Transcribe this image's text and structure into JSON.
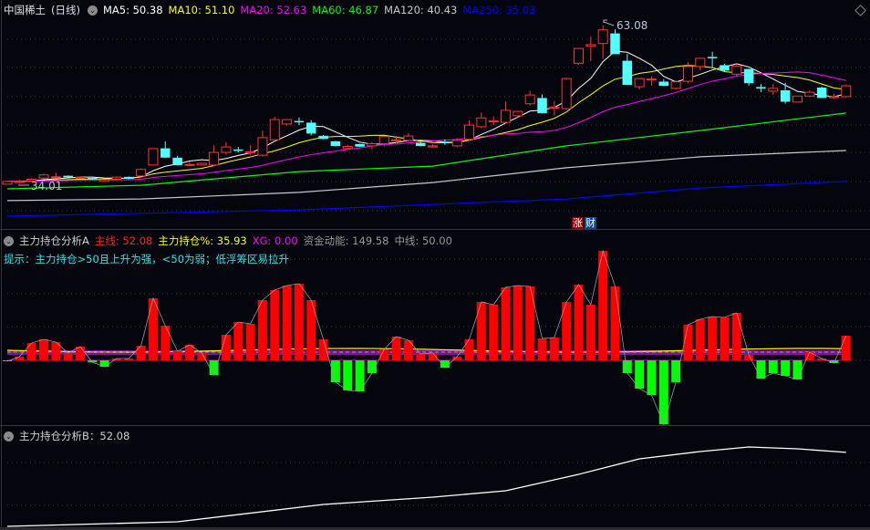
{
  "main": {
    "stock_name": "中国稀土",
    "period": "(日线)",
    "ma_labels": [
      {
        "text": "MA5: 50.38",
        "color": "#ffffff"
      },
      {
        "text": "MA10: 51.10",
        "color": "#ffff00"
      },
      {
        "text": "MA20: 52.63",
        "color": "#ff00ff"
      },
      {
        "text": "MA60: 46.87",
        "color": "#00ff00"
      },
      {
        "text": "MA120: 40.43",
        "color": "#c8c8c8"
      },
      {
        "text": "MA250: 35.03",
        "color": "#0000ff"
      }
    ],
    "high_label": "63.08",
    "low_label": "34.01",
    "tag1": "涨",
    "tag2": "财",
    "colors": {
      "up": "#ff3232",
      "down": "#54ffff"
    }
  },
  "panel_a": {
    "title": "主力持仓分析A",
    "items": [
      {
        "text": "主线: 52.08",
        "color": "#ff2020"
      },
      {
        "text": "主力持仓%: 35.93",
        "color": "#ffff00"
      },
      {
        "text": "XG: 0.00",
        "color": "#ff00ff"
      },
      {
        "text": "资金动能: 149.58",
        "color": "#9a9a9a"
      },
      {
        "text": "中线: 50.00",
        "color": "#9a9a9a"
      }
    ],
    "hint": "提示：主力持仓>50且上升为强，<50为弱；低浮筹区易拉升"
  },
  "panel_b": {
    "title": "主力持仓分析B：52.08"
  },
  "chart_data": [
    {
      "type": "candlestick",
      "title": "中国稀土 (日线)",
      "price_range": [
        26.5,
        65
      ],
      "ohlc": [
        [
          34.1,
          34.7,
          34.01,
          34.6
        ],
        [
          34.4,
          34.9,
          34.2,
          34.6
        ],
        [
          34.7,
          35.2,
          34.5,
          35.0
        ],
        [
          35.2,
          36.0,
          35.0,
          35.8
        ],
        [
          35.4,
          36.2,
          35.3,
          35.45
        ],
        [
          35.6,
          35.7,
          35.3,
          35.4
        ],
        [
          35.3,
          35.5,
          35.1,
          35.35
        ],
        [
          35.2,
          35.3,
          34.9,
          35.0
        ],
        [
          34.6,
          35.0,
          34.5,
          34.9
        ],
        [
          35.0,
          35.5,
          34.9,
          35.4
        ],
        [
          35.4,
          35.5,
          35.0,
          35.1
        ],
        [
          35.6,
          37.0,
          35.5,
          36.8
        ],
        [
          37.6,
          40.6,
          37.5,
          40.6
        ],
        [
          40.6,
          41.9,
          38.9,
          39.0
        ],
        [
          38.9,
          39.3,
          37.5,
          37.6
        ],
        [
          37.6,
          38.2,
          37.4,
          37.7
        ],
        [
          37.6,
          38.0,
          37.5,
          37.9
        ],
        [
          37.6,
          41.2,
          37.4,
          39.9
        ],
        [
          39.9,
          41.8,
          39.5,
          40.9
        ],
        [
          40.4,
          40.9,
          39.9,
          40.35
        ],
        [
          39.8,
          41.2,
          39.5,
          40.0
        ],
        [
          39.4,
          43.9,
          39.2,
          42.6
        ],
        [
          42.2,
          46.4,
          41.9,
          45.9
        ],
        [
          45.1,
          46.0,
          44.8,
          45.9
        ],
        [
          45.6,
          46.3,
          44.9,
          45.5
        ],
        [
          45.3,
          45.8,
          43.0,
          43.4
        ],
        [
          42.9,
          43.1,
          42.3,
          42.4
        ],
        [
          41.9,
          42.0,
          41.0,
          41.1
        ],
        [
          40.6,
          41.3,
          40.4,
          41.0
        ],
        [
          41.4,
          41.5,
          40.9,
          41.0
        ],
        [
          41.1,
          41.8,
          40.5,
          41.5
        ],
        [
          41.5,
          42.9,
          41.0,
          42.8
        ],
        [
          42.1,
          42.9,
          41.6,
          42.2
        ],
        [
          42.1,
          43.4,
          41.9,
          42.9
        ],
        [
          41.6,
          41.8,
          41.0,
          41.1
        ],
        [
          40.9,
          41.4,
          40.8,
          41.1
        ],
        [
          41.8,
          42.3,
          41.3,
          41.7
        ],
        [
          41.1,
          42.5,
          40.9,
          42.1
        ],
        [
          42.3,
          45.8,
          42.0,
          44.9
        ],
        [
          44.6,
          47.2,
          44.3,
          46.2
        ],
        [
          45.6,
          46.5,
          44.9,
          45.65
        ],
        [
          45.4,
          49.2,
          45.2,
          47.6
        ],
        [
          46.6,
          47.5,
          46.3,
          47.4
        ],
        [
          48.8,
          51.2,
          48.5,
          50.4
        ],
        [
          49.8,
          50.5,
          47.0,
          47.1
        ],
        [
          48.0,
          49.3,
          46.6,
          48.2
        ],
        [
          47.9,
          53.6,
          47.7,
          53.4
        ],
        [
          56.2,
          59.0,
          55.9,
          58.9
        ],
        [
          59.3,
          61.1,
          56.6,
          59.6
        ],
        [
          59.8,
          63.08,
          57.0,
          62.3
        ],
        [
          61.6,
          62.4,
          58.0,
          57.9
        ],
        [
          56.6,
          57.9,
          52.2,
          52.3
        ],
        [
          51.9,
          53.5,
          51.4,
          53.4
        ],
        [
          53.2,
          53.8,
          52.1,
          53.3
        ],
        [
          52.8,
          53.3,
          52.0,
          52.1
        ],
        [
          51.6,
          53.1,
          51.4,
          52.8
        ],
        [
          52.9,
          56.4,
          52.6,
          55.6
        ],
        [
          55.6,
          57.2,
          54.9,
          57.1
        ],
        [
          57.3,
          58.3,
          55.3,
          57.25
        ],
        [
          55.8,
          56.1,
          54.7,
          54.9
        ],
        [
          54.2,
          56.1,
          53.8,
          55.7
        ],
        [
          55.1,
          55.2,
          52.1,
          52.6
        ],
        [
          51.8,
          52.4,
          50.9,
          51.75
        ],
        [
          51.1,
          52.4,
          50.4,
          51.6
        ],
        [
          51.2,
          52.6,
          48.8,
          49.2
        ],
        [
          49.1,
          50.2,
          49.0,
          50.2
        ],
        [
          50.2,
          51.2,
          50.0,
          50.9
        ],
        [
          51.7,
          51.9,
          49.8,
          49.9
        ],
        [
          49.9,
          50.6,
          49.7,
          50.1
        ],
        [
          50.1,
          52.3,
          49.9,
          52.08
        ]
      ],
      "ma_long": {
        "MA60": [
          [
            0,
            33.25
          ],
          [
            11,
            33.9
          ],
          [
            24,
            36.4
          ],
          [
            35,
            37.4
          ],
          [
            46,
            41.1
          ],
          [
            57,
            43.9
          ],
          [
            69,
            47.1
          ]
        ],
        "MA120": [
          [
            0,
            31.1
          ],
          [
            11,
            31.4
          ],
          [
            24,
            32.6
          ],
          [
            35,
            34.4
          ],
          [
            46,
            37.1
          ],
          [
            57,
            39.1
          ],
          [
            69,
            40.25
          ]
        ],
        "MA250": [
          [
            0,
            28.25
          ],
          [
            24,
            29.4
          ],
          [
            35,
            30.4
          ],
          [
            46,
            31.4
          ],
          [
            57,
            33.4
          ],
          [
            69,
            34.6
          ]
        ]
      }
    },
    {
      "type": "bar",
      "title": "主力持仓分析A",
      "value_range": [
        -75,
        125
      ],
      "values": [
        -1,
        4,
        19,
        23,
        20,
        8,
        15,
        -2,
        -7,
        2,
        2,
        16,
        68,
        38,
        10,
        17,
        8,
        -16,
        28,
        42,
        40,
        66,
        77,
        82,
        84,
        66,
        23,
        -24,
        -33,
        -34,
        -14,
        12,
        26,
        22,
        7,
        8,
        -8,
        4,
        23,
        64,
        61,
        80,
        82,
        81,
        24,
        25,
        64,
        83,
        61,
        120,
        81,
        -14,
        -31,
        -38,
        -70,
        -24,
        39,
        45,
        48,
        47,
        52,
        6,
        -20,
        -14,
        -17,
        -21,
        9,
        2,
        -3,
        27
      ]
    },
    {
      "type": "line",
      "title": "主力持仓分析B",
      "value_range": [
        0,
        75
      ],
      "points": [
        [
          0,
          11.5
        ],
        [
          14,
          14
        ],
        [
          26,
          23.5
        ],
        [
          35,
          27.5
        ],
        [
          41,
          31
        ],
        [
          47,
          40
        ],
        [
          52,
          48.5
        ],
        [
          57,
          52.5
        ],
        [
          61,
          55
        ],
        [
          65,
          54
        ],
        [
          69,
          52.08
        ]
      ]
    }
  ]
}
